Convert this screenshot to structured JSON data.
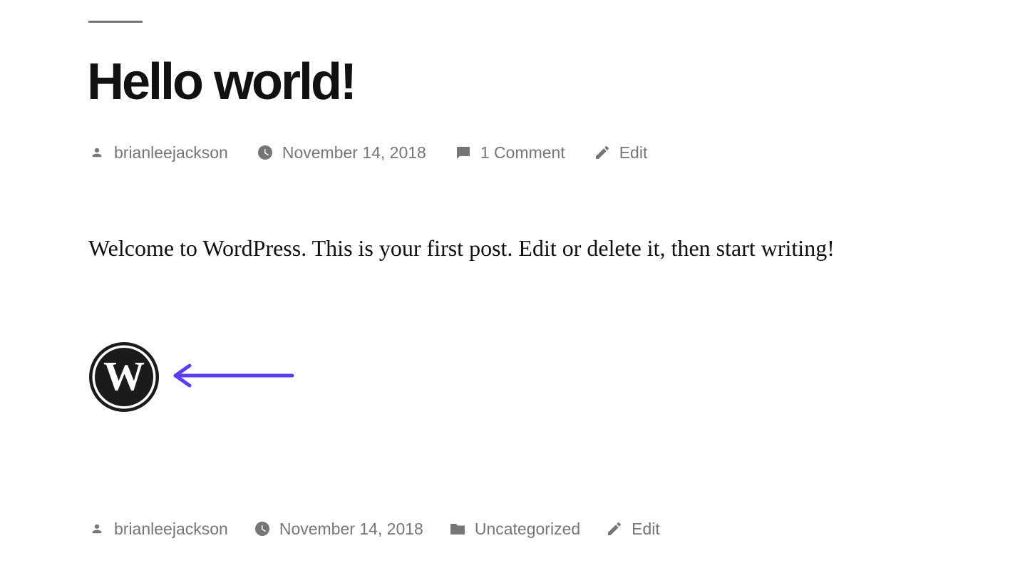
{
  "post": {
    "title": "Hello world!",
    "body": "Welcome to WordPress. This is your first post. Edit or delete it, then start writing!"
  },
  "meta_top": {
    "author": "brianleejackson",
    "date": "November 14, 2018",
    "comments": "1 Comment",
    "edit": "Edit"
  },
  "meta_bottom": {
    "author": "brianleejackson",
    "date": "November 14, 2018",
    "category": "Uncategorized",
    "edit": "Edit"
  },
  "colors": {
    "meta_text": "#767676",
    "title_text": "#111111",
    "arrow": "#5b3df5"
  },
  "icons": {
    "author": "person-icon",
    "date": "clock-icon",
    "comments": "comment-icon",
    "category": "folder-icon",
    "edit": "pencil-icon",
    "logo": "wordpress-logo-icon",
    "annotation": "arrow-left-icon"
  }
}
